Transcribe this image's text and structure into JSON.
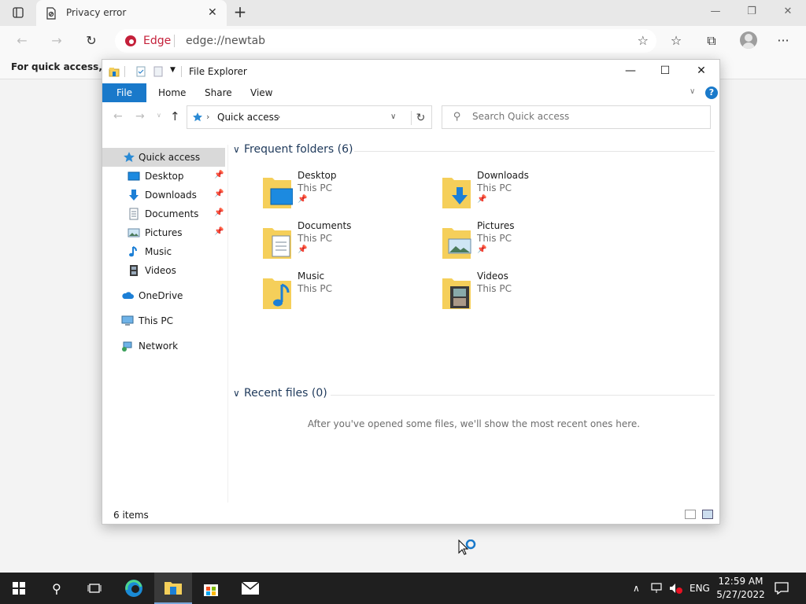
{
  "browser": {
    "tab_title": "Privacy error",
    "brand_label": "Edge",
    "url": "edge://newtab",
    "favorites_bar_text": "For quick access, plac"
  },
  "explorer": {
    "window_title": "File Explorer",
    "ribbon_tabs": [
      "File",
      "Home",
      "Share",
      "View"
    ],
    "breadcrumb": "Quick access",
    "search_placeholder": "Search Quick access",
    "sidebar": {
      "quick_access": "Quick access",
      "pinned": [
        {
          "label": "Desktop",
          "pinned": true
        },
        {
          "label": "Downloads",
          "pinned": true
        },
        {
          "label": "Documents",
          "pinned": true
        },
        {
          "label": "Pictures",
          "pinned": true
        },
        {
          "label": "Music",
          "pinned": false
        },
        {
          "label": "Videos",
          "pinned": false
        }
      ],
      "onedrive": "OneDrive",
      "this_pc": "This PC",
      "network": "Network"
    },
    "frequent_header": "Frequent folders (6)",
    "folders": [
      {
        "name": "Desktop",
        "location": "This PC",
        "pinned": true
      },
      {
        "name": "Downloads",
        "location": "This PC",
        "pinned": true
      },
      {
        "name": "Documents",
        "location": "This PC",
        "pinned": true
      },
      {
        "name": "Pictures",
        "location": "This PC",
        "pinned": true
      },
      {
        "name": "Music",
        "location": "This PC",
        "pinned": false
      },
      {
        "name": "Videos",
        "location": "This PC",
        "pinned": false
      }
    ],
    "recent_header": "Recent files (0)",
    "recent_empty_message": "After you've opened some files, we'll show the most recent ones here.",
    "status_count": "6 items"
  },
  "taskbar": {
    "language": "ENG",
    "time": "12:59 AM",
    "date": "5/27/2022"
  },
  "colors": {
    "accent": "#1979ca",
    "edge_red": "#c4203a",
    "folder_yellow": "#f5cf5a",
    "taskbar_bg": "#1f1f1f"
  }
}
